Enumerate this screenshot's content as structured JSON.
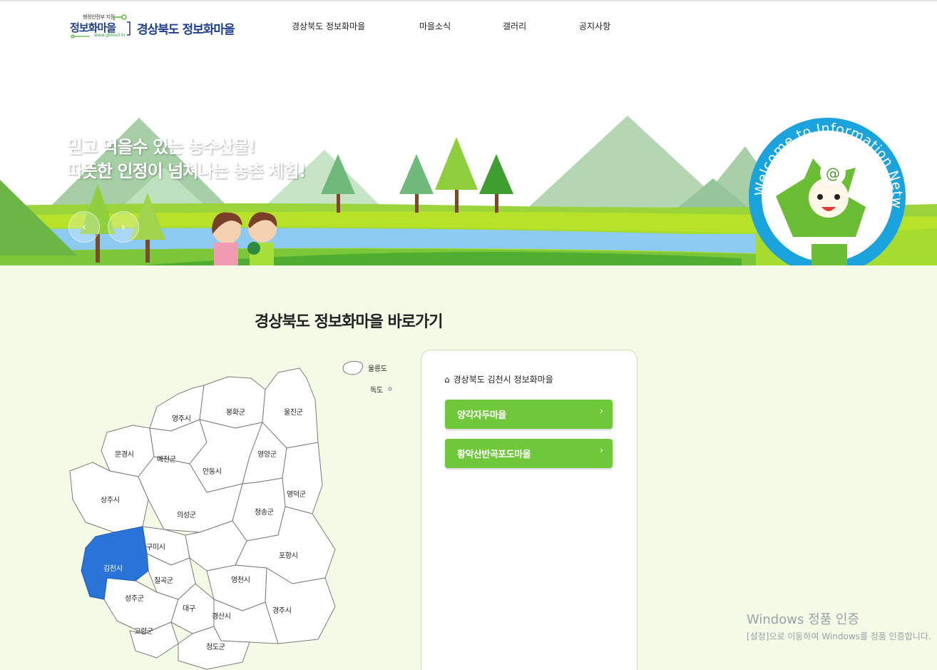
{
  "header": {
    "logo": {
      "sub": "행정안전부 지정",
      "main": "정보화마을",
      "url": "www.gbinvil.kr",
      "title": "경상북도 정보화마을"
    },
    "nav": [
      {
        "label": "경상북도 정보화마을"
      },
      {
        "label": "마을소식"
      },
      {
        "label": "갤러리"
      },
      {
        "label": "공지사항"
      }
    ]
  },
  "hero": {
    "line1": "믿고 먹을수 있는 농수산물!",
    "line2": "따뜻한 인정이 넘쳐나는 농촌 체험!",
    "badge_text": "Welcome to Information Network Village",
    "prev_icon": "‹",
    "next_icon": "›"
  },
  "shortcut": {
    "title": "경상북도 정보화마을 바로가기",
    "selected_region": "김천시",
    "regions": [
      {
        "name": "울릉도"
      },
      {
        "name": "독도"
      },
      {
        "name": "영주시"
      },
      {
        "name": "봉화군"
      },
      {
        "name": "울진군"
      },
      {
        "name": "문경시"
      },
      {
        "name": "예천군"
      },
      {
        "name": "안동시"
      },
      {
        "name": "영양군"
      },
      {
        "name": "영덕군"
      },
      {
        "name": "상주시"
      },
      {
        "name": "의성군"
      },
      {
        "name": "청송군"
      },
      {
        "name": "구미시"
      },
      {
        "name": "김천시"
      },
      {
        "name": "칠곡군"
      },
      {
        "name": "영천시"
      },
      {
        "name": "포항시"
      },
      {
        "name": "성주군"
      },
      {
        "name": "대구"
      },
      {
        "name": "경산시"
      },
      {
        "name": "경주시"
      },
      {
        "name": "고령군"
      },
      {
        "name": "청도군"
      }
    ],
    "panel": {
      "heading": "경상북도 김천시 정보화마을",
      "villages": [
        {
          "label": "양각자두마을"
        },
        {
          "label": "황악산반곡포도마을"
        }
      ]
    }
  },
  "watermark": {
    "line1": "Windows 정품 인증",
    "line2": "[설정]으로 이동하여 Windows를 정품 인증합니다."
  },
  "colors": {
    "brand_blue": "#1e3f8f",
    "accent_green": "#6ec83a",
    "selected_region": "#2a73d8",
    "lower_background": "#f3fbe6"
  }
}
